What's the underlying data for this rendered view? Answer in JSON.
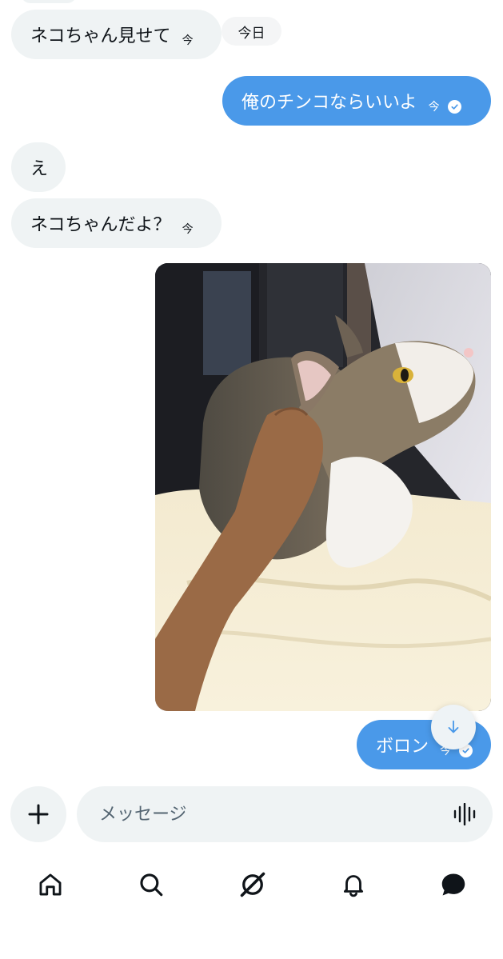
{
  "date_divider": "今日",
  "messages": [
    {
      "text": "ネコちゃん見せて",
      "time": "今"
    },
    {
      "text": "俺のチンコならいいよ",
      "time": "今"
    },
    {
      "text": "え",
      "time": ""
    },
    {
      "text": "ネコちゃんだよ？",
      "time": "今"
    },
    {
      "text": "ボロン",
      "time": "今"
    }
  ],
  "photo": {
    "alt": "cat photo"
  },
  "composer": {
    "placeholder": "メッセージ"
  },
  "nav": [
    "home-icon",
    "search-icon",
    "grok-icon",
    "notifications-icon",
    "messages-icon"
  ],
  "colors": {
    "accent": "#4a99e9",
    "incoming_bubble": "#eff3f4"
  }
}
